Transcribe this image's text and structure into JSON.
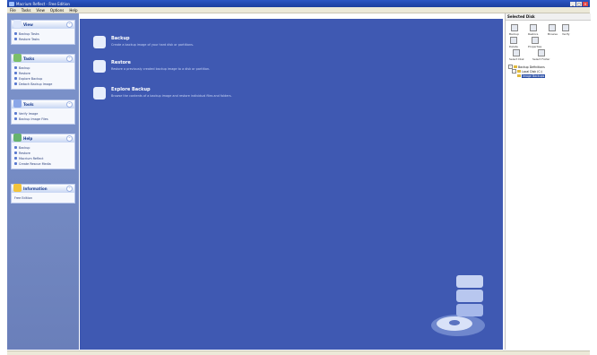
{
  "window": {
    "title": "Macrium Reflect - Free Edition"
  },
  "menu": {
    "items": [
      "File",
      "Tasks",
      "View",
      "Options",
      "Help"
    ]
  },
  "sidebar": {
    "groups": [
      {
        "title": "View",
        "icon": "view-icon",
        "items": [
          "Backup Tasks",
          "Restore Tasks"
        ]
      },
      {
        "title": "Tasks",
        "icon": "tasks-icon",
        "items": [
          "Backup",
          "Restore",
          "Explore Backup",
          "Detach Backup Image"
        ]
      },
      {
        "title": "Tools",
        "icon": "tools-icon",
        "items": [
          "Verify Image",
          "Backup Image Files"
        ]
      },
      {
        "title": "Help",
        "icon": "help-icon",
        "items": [
          "Backup",
          "Restore",
          "Macrium Reflect",
          "Create Rescue Media"
        ]
      },
      {
        "title": "Information",
        "icon": "information-icon",
        "items": [
          "Free Edition"
        ]
      }
    ]
  },
  "main": {
    "tasks": [
      {
        "name": "Backup",
        "desc": "Create a backup image of your hard disk or partitions."
      },
      {
        "name": "Restore",
        "desc": "Restore a previously created backup image to a disk or partition."
      },
      {
        "name": "Explore Backup",
        "desc": "Browse the contents of a backup image and restore individual files and folders."
      }
    ]
  },
  "rpanel": {
    "title": "Selected Disk",
    "toolbar": [
      "Backup",
      "Restore",
      "Browse",
      "Verify",
      "Delete",
      "Properties"
    ],
    "buttons": [
      "Select Disk",
      "Select Folder"
    ],
    "tree": [
      "Backup Definitions",
      "Local Disk (C:)",
      "Image Backups"
    ]
  },
  "status": ""
}
